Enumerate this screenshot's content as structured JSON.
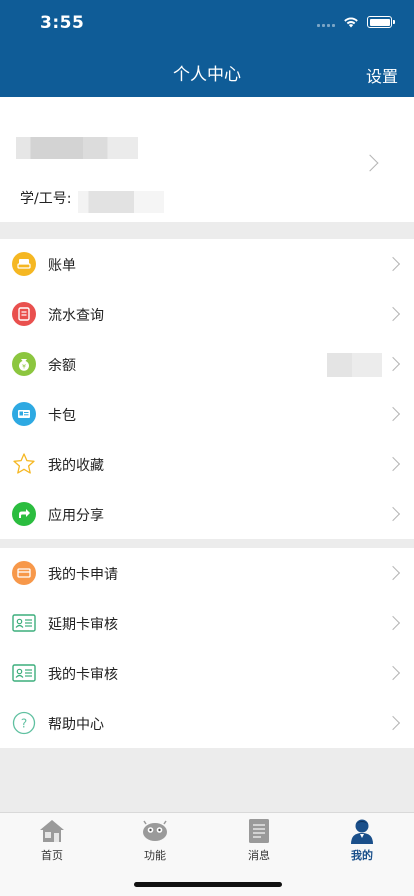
{
  "status": {
    "time": "3:55"
  },
  "nav": {
    "title": "个人中心",
    "settings": "设置"
  },
  "profile": {
    "id_label": "学/工号:"
  },
  "menu_group1": [
    {
      "label": "账单",
      "icon": "bill-icon",
      "color": "#f5b722"
    },
    {
      "label": "流水查询",
      "icon": "transaction-icon",
      "color": "#e9504e"
    },
    {
      "label": "余额",
      "icon": "money-bag-icon",
      "color": "#8cc63f"
    },
    {
      "label": "卡包",
      "icon": "card-wallet-icon",
      "color": "#2ea9e2"
    },
    {
      "label": "我的收藏",
      "icon": "star-icon",
      "color": "#f5b722"
    },
    {
      "label": "应用分享",
      "icon": "share-icon",
      "color": "#2bbd3f"
    }
  ],
  "menu_group2": [
    {
      "label": "我的卡申请",
      "icon": "card-apply-icon",
      "color": "#f7984a"
    },
    {
      "label": "延期卡审核",
      "icon": "id-card-icon",
      "color": "#3cae7c"
    },
    {
      "label": "我的卡审核",
      "icon": "id-card-icon",
      "color": "#3cae7c"
    },
    {
      "label": "帮助中心",
      "icon": "help-icon",
      "color": "#5fc0a0"
    }
  ],
  "tabs": [
    {
      "label": "首页",
      "icon": "home-icon"
    },
    {
      "label": "功能",
      "icon": "robot-icon"
    },
    {
      "label": "消息",
      "icon": "message-icon"
    },
    {
      "label": "我的",
      "icon": "user-icon",
      "active": true
    }
  ],
  "colors": {
    "header": "#0f5c97",
    "active_tab": "#1a4f8a"
  }
}
